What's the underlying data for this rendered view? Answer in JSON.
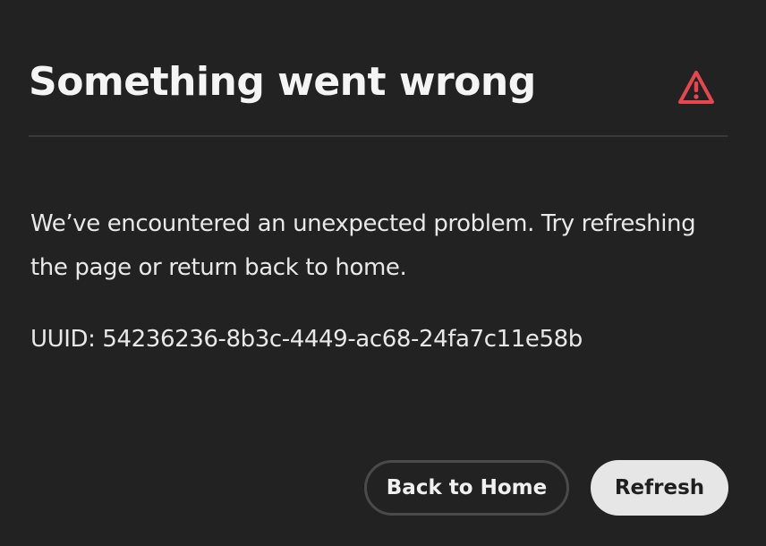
{
  "dialog": {
    "title": "Something went wrong",
    "icon": "alert-triangle-icon",
    "icon_color": "#e34850",
    "message": "We’ve encountered an unexpected problem. Try refreshing the page or return back to home.",
    "uuid_text": "UUID: 54236236-8b3c-4449-ac68-24fa7c11e58b"
  },
  "actions": {
    "back_label": "Back to Home",
    "refresh_label": "Refresh"
  }
}
